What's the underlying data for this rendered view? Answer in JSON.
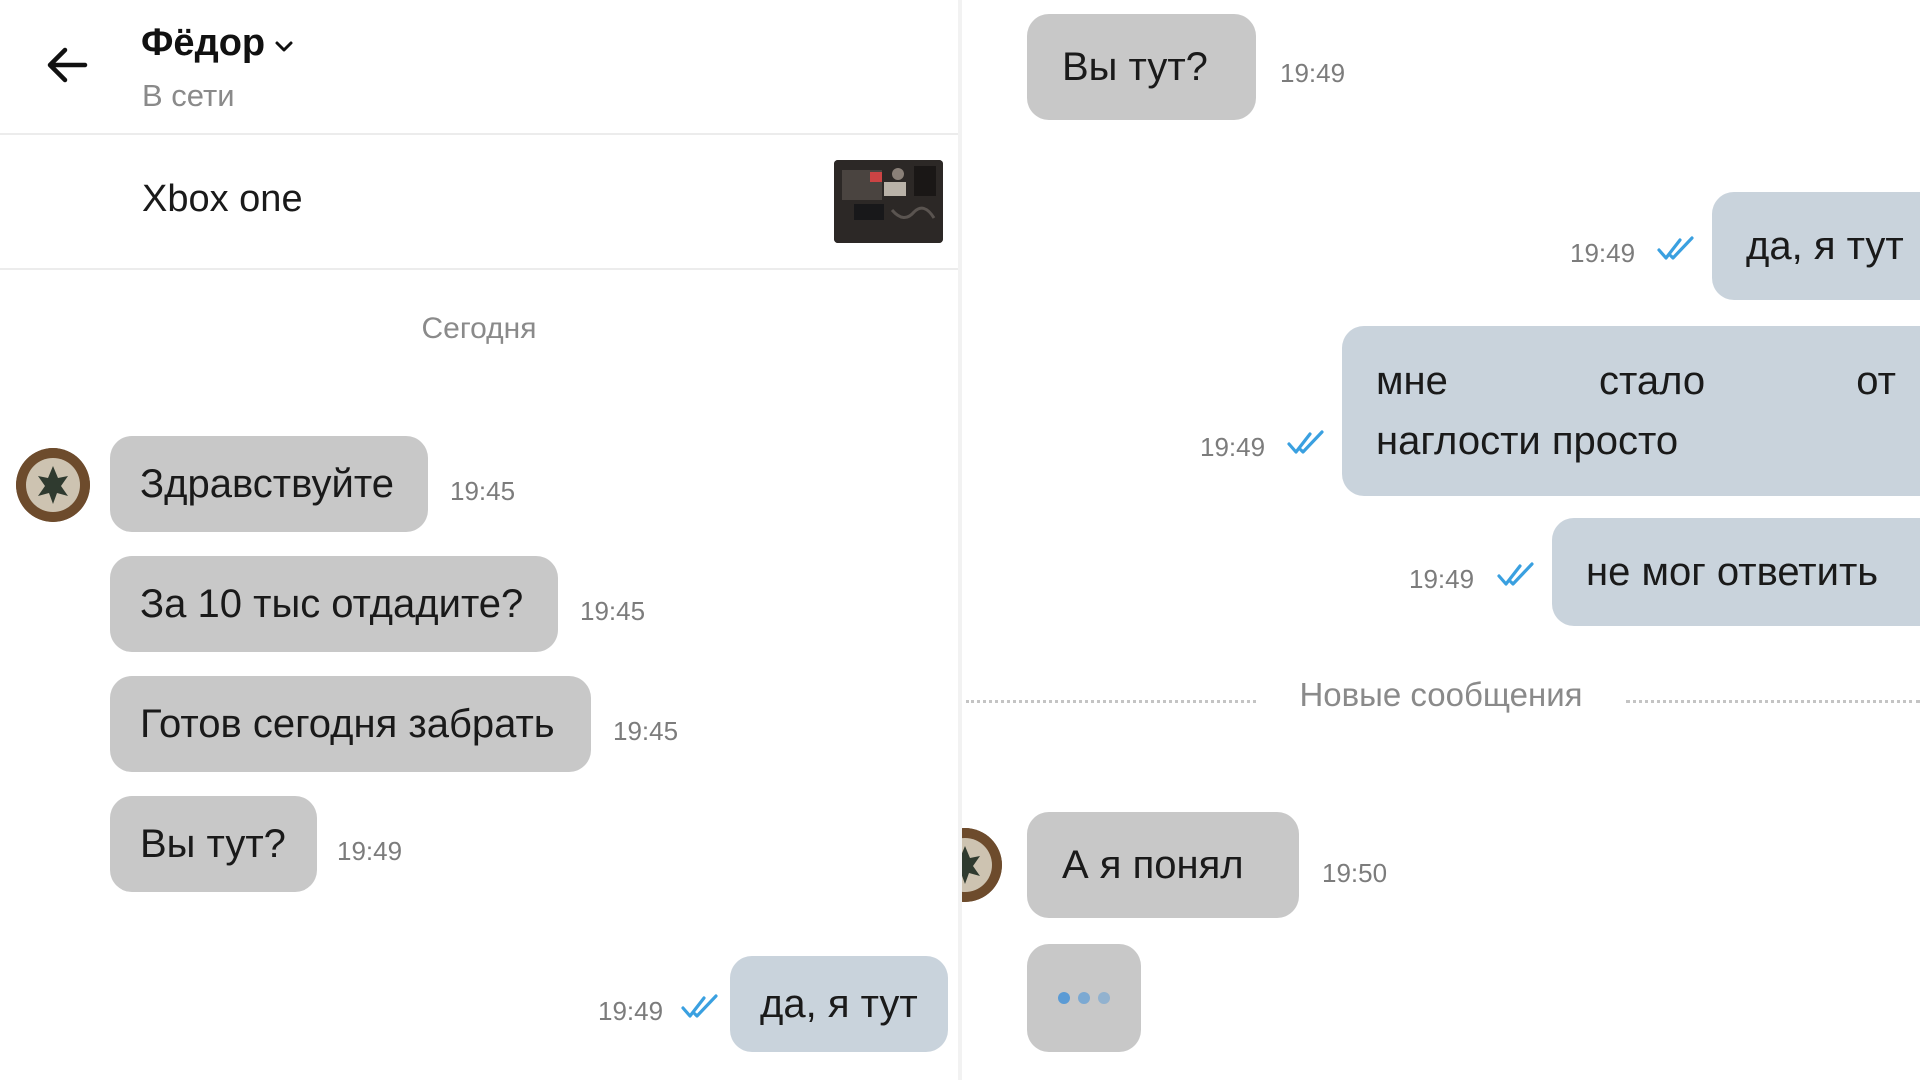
{
  "header": {
    "back_icon": "arrow-left-icon",
    "contact_name": "Фёдор",
    "name_chevron_icon": "chevron-down-icon",
    "status": "В сети"
  },
  "listing": {
    "title": "Xbox one",
    "thumbnail_icon": "listing-photo"
  },
  "chat_left": {
    "date_label": "Сегодня",
    "messages": [
      {
        "text": "Здравствуйте",
        "time": "19:45",
        "direction": "incoming"
      },
      {
        "text": "За 10 тыс отдадите?",
        "time": "19:45",
        "direction": "incoming"
      },
      {
        "text": "Готов сегодня забрать",
        "time": "19:45",
        "direction": "incoming"
      },
      {
        "text": "Вы тут?",
        "time": "19:49",
        "direction": "incoming"
      },
      {
        "text": "да, я тут",
        "time": "19:49",
        "direction": "outgoing",
        "read": true
      }
    ]
  },
  "chat_right": {
    "messages": [
      {
        "text": "Вы тут?",
        "time": "19:49",
        "direction": "incoming"
      },
      {
        "text": "да, я тут",
        "time": "19:49",
        "direction": "outgoing",
        "read": true
      },
      {
        "line1": "мне стало от такой",
        "line2": "наглости просто",
        "time": "19:49",
        "direction": "outgoing",
        "read": true
      },
      {
        "text": "не мог ответить",
        "time": "19:49",
        "direction": "outgoing",
        "read": true
      },
      {
        "text": "А я понял",
        "time": "19:50",
        "direction": "incoming"
      }
    ],
    "new_messages_label": "Новые сообщения",
    "typing_icon": "typing-dots-icon"
  },
  "colors": {
    "incoming_bubble": "#c8c8c8",
    "outgoing_bubble": "#c9d3dc",
    "read_tick": "#3aa0e0",
    "muted_text": "#8a8a8a"
  }
}
